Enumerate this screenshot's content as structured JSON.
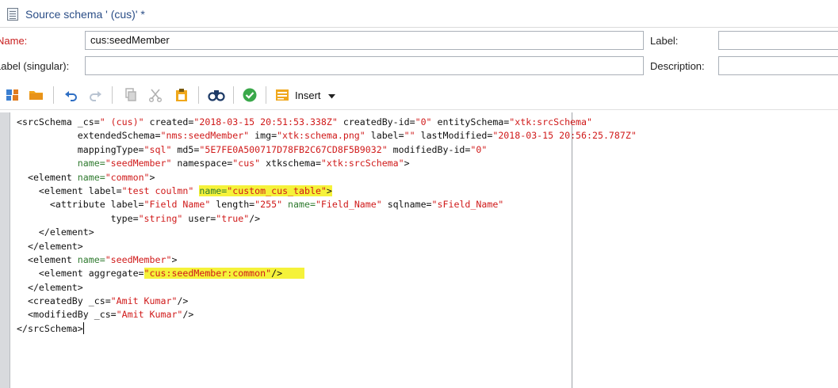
{
  "window": {
    "title": "Source schema ' (cus)' *"
  },
  "form": {
    "name_label": "Name:",
    "name_value": "cus:seedMember",
    "label_label": "Label:",
    "label_value": "",
    "label_singular_label": "Label (singular):",
    "label_singular_value": "",
    "description_label": "Description:",
    "description_value": ""
  },
  "toolbar": {
    "insert_label": "Insert",
    "icons": [
      "new-schema-icon",
      "open-folder-icon",
      "undo-icon",
      "redo-icon",
      "copy-icon",
      "cut-icon",
      "paste-icon",
      "find-icon",
      "validate-icon",
      "insert-icon",
      "chevron-down-icon"
    ]
  },
  "editor": {
    "lines": [
      [
        {
          "t": "t",
          "v": "<srcSchema "
        },
        {
          "t": "t",
          "v": "_cs="
        },
        {
          "t": "av",
          "v": "\" (cus)\""
        },
        {
          "t": "t",
          "v": " created="
        },
        {
          "t": "av",
          "v": "\"2018-03-15 20:51:53.338Z\""
        },
        {
          "t": "t",
          "v": " createdBy-id="
        },
        {
          "t": "av",
          "v": "\"0\""
        },
        {
          "t": "t",
          "v": " entitySchema="
        },
        {
          "t": "av",
          "v": "\"xtk:srcSchema\""
        }
      ],
      [
        {
          "t": "t",
          "v": "           extendedSchema="
        },
        {
          "t": "av",
          "v": "\"nms:seedMember\""
        },
        {
          "t": "t",
          "v": " img="
        },
        {
          "t": "av",
          "v": "\"xtk:schema.png\""
        },
        {
          "t": "t",
          "v": " label="
        },
        {
          "t": "av",
          "v": "\"\""
        },
        {
          "t": "t",
          "v": " lastModified="
        },
        {
          "t": "av",
          "v": "\"2018-03-15 20:56:25.787Z\""
        }
      ],
      [
        {
          "t": "t",
          "v": "           mappingType="
        },
        {
          "t": "av",
          "v": "\"sql\""
        },
        {
          "t": "t",
          "v": " md5="
        },
        {
          "t": "av",
          "v": "\"5E7FE0A500717D78FB2C67CD8F5B9032\""
        },
        {
          "t": "t",
          "v": " modifiedBy-id="
        },
        {
          "t": "av",
          "v": "\"0\""
        }
      ],
      [
        {
          "t": "t",
          "v": "           "
        },
        {
          "t": "an",
          "v": "name="
        },
        {
          "t": "av",
          "v": "\"seedMember\""
        },
        {
          "t": "t",
          "v": " namespace="
        },
        {
          "t": "av",
          "v": "\"cus\""
        },
        {
          "t": "t",
          "v": " xtkschema="
        },
        {
          "t": "av",
          "v": "\"xtk:srcSchema\""
        },
        {
          "t": "t",
          "v": ">"
        }
      ],
      [
        {
          "t": "t",
          "v": "  <element "
        },
        {
          "t": "an",
          "v": "name="
        },
        {
          "t": "av",
          "v": "\"common\""
        },
        {
          "t": "t",
          "v": ">"
        }
      ],
      [
        {
          "t": "t",
          "v": "    <element label="
        },
        {
          "t": "av",
          "v": "\"test coulmn\""
        },
        {
          "t": "t",
          "v": " "
        },
        {
          "t": "an",
          "v": "name=",
          "h": true
        },
        {
          "t": "av",
          "v": "\"custom_cus_table\"",
          "h": true
        },
        {
          "t": "t",
          "v": ">",
          "h": true
        }
      ],
      [
        {
          "t": "t",
          "v": "      <attribute label="
        },
        {
          "t": "av",
          "v": "\"Field Name\""
        },
        {
          "t": "t",
          "v": " length="
        },
        {
          "t": "av",
          "v": "\"255\""
        },
        {
          "t": "t",
          "v": " "
        },
        {
          "t": "an",
          "v": "name="
        },
        {
          "t": "av",
          "v": "\"Field_Name\""
        },
        {
          "t": "t",
          "v": " sqlname="
        },
        {
          "t": "av",
          "v": "\"sField_Name\""
        }
      ],
      [
        {
          "t": "t",
          "v": "                 type="
        },
        {
          "t": "av",
          "v": "\"string\""
        },
        {
          "t": "t",
          "v": " user="
        },
        {
          "t": "av",
          "v": "\"true\""
        },
        {
          "t": "t",
          "v": "/>"
        }
      ],
      [
        {
          "t": "t",
          "v": "    </element>"
        }
      ],
      [
        {
          "t": "t",
          "v": "  </element>"
        }
      ],
      [
        {
          "t": "t",
          "v": "  <element "
        },
        {
          "t": "an",
          "v": "name="
        },
        {
          "t": "av",
          "v": "\"seedMember\""
        },
        {
          "t": "t",
          "v": ">"
        }
      ],
      [
        {
          "t": "t",
          "v": "    <element aggregate="
        },
        {
          "t": "av",
          "v": "\"cus:seedMember:common\"",
          "h": true
        },
        {
          "t": "t",
          "v": "/>",
          "h": true
        },
        {
          "t": "t",
          "v": "    ",
          "h": true
        }
      ],
      [
        {
          "t": "t",
          "v": "  </element>"
        }
      ],
      [
        {
          "t": "t",
          "v": "  <createdBy "
        },
        {
          "t": "t",
          "v": "_cs="
        },
        {
          "t": "av",
          "v": "\"Amit Kumar\""
        },
        {
          "t": "t",
          "v": "/>"
        }
      ],
      [
        {
          "t": "t",
          "v": "  <modifiedBy "
        },
        {
          "t": "t",
          "v": "_cs="
        },
        {
          "t": "av",
          "v": "\"Amit Kumar\""
        },
        {
          "t": "t",
          "v": "/>"
        }
      ],
      [
        {
          "t": "t",
          "v": "</srcSchema>"
        }
      ]
    ]
  },
  "colors": {
    "attr_value": "#d01a1a",
    "attr_name": "#2f7a2f",
    "highlight": "#f5f23a",
    "required_label": "#c81e1e",
    "title": "#2b4e87"
  }
}
